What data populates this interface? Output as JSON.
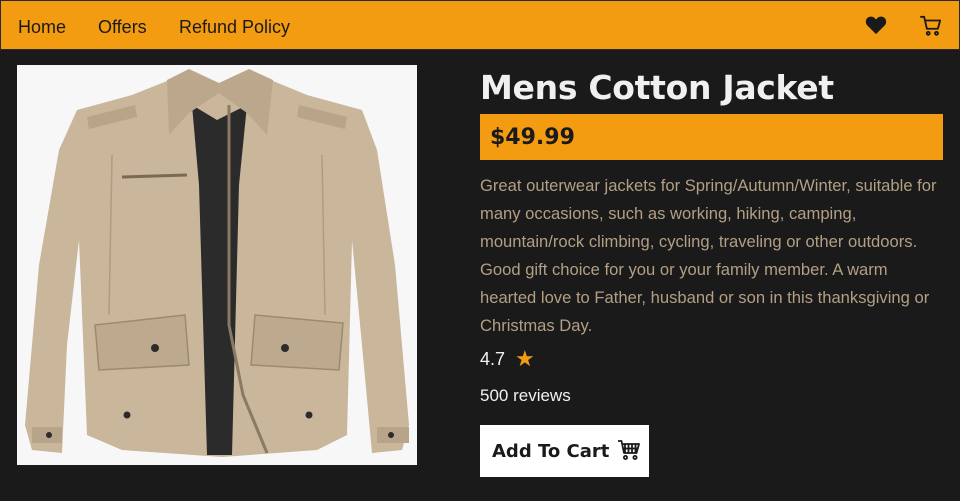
{
  "nav": {
    "links": [
      "Home",
      "Offers",
      "Refund Policy"
    ],
    "icons": [
      "heart-icon",
      "cart-icon"
    ]
  },
  "product": {
    "title": "Mens Cotton Jacket",
    "price": "$49.99",
    "description": "Great outerwear jackets for Spring/Autumn/Winter, suitable for many occasions, such as working, hiking, camping, mountain/rock climbing, cycling, traveling or other outdoors. Good gift choice for you or your family member. A warm hearted love to Father, husband or son in this thanksgiving or Christmas Day.",
    "rating": "4.7",
    "rating_icon": "star-icon",
    "reviews": "500 reviews",
    "add_to_cart_label": "Add To Cart",
    "add_to_cart_icon": "cart-icon"
  },
  "colors": {
    "accent": "#f39c12",
    "background": "#1a1a1a",
    "description_text": "#b39f84",
    "star": "#f39c12"
  }
}
